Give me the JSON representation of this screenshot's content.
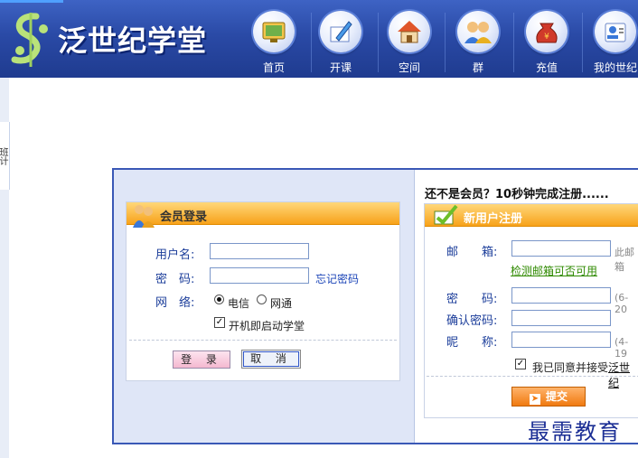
{
  "header": {
    "logo_text": "泛世纪学堂",
    "nav": [
      {
        "label": "首页",
        "icon": "home-screen-icon"
      },
      {
        "label": "开课",
        "icon": "pencil-paper-icon"
      },
      {
        "label": "空间",
        "icon": "house-icon"
      },
      {
        "label": "群",
        "icon": "group-people-icon"
      },
      {
        "label": "充值",
        "icon": "money-bag-icon"
      },
      {
        "label": "我的世纪",
        "icon": "user-card-icon"
      }
    ]
  },
  "sidebar": {
    "tab_label": "班计"
  },
  "login": {
    "title": "会员登录",
    "username_label": "用户名:",
    "username_value": "",
    "password_label": "密　码:",
    "password_value": "",
    "forgot_link": "忘记密码",
    "network_label": "网　络:",
    "network_options": [
      "电信",
      "网通"
    ],
    "network_selected": "电信",
    "autostart_label": "开机即启动学堂",
    "autostart_checked": true,
    "login_button": "登 录",
    "cancel_button": "取 消"
  },
  "register": {
    "headline": "还不是会员？10秒钟完成注册......",
    "title": "新用户注册",
    "email_label": "邮　　箱:",
    "email_value": "",
    "email_hint": "此邮箱",
    "check_email_link": "检测邮箱可否可用",
    "password_label": "密　　码:",
    "password_value": "",
    "password_hint": "(6-20",
    "confirm_label": "确认密码:",
    "confirm_value": "",
    "nickname_label": "昵　　称:",
    "nickname_value": "",
    "nickname_hint": "(4-19",
    "agree_label": "我已同意并接受",
    "agree_link": "泛世纪",
    "agree_checked": true,
    "submit_button": "提交"
  },
  "watermark": "最需教育",
  "colors": {
    "header_blue": "#2a4aa6",
    "panel_border": "#3a58b6",
    "orange": "#f7a21a",
    "link_blue": "#1d46b8",
    "link_green": "#2f8a00"
  }
}
